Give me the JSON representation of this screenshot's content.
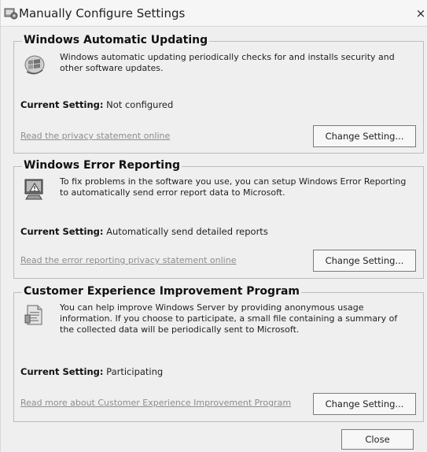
{
  "window": {
    "title": "Manually Configure Settings",
    "close_glyph": "×"
  },
  "groups": [
    {
      "title": "Windows Automatic Updating",
      "icon": "windows-update-icon",
      "description": "Windows automatic updating periodically checks for and installs security and other software updates.",
      "setting_label": "Current Setting:",
      "setting_value": "Not configured",
      "link": "Read the privacy statement online",
      "button": "Change Setting..."
    },
    {
      "title": "Windows Error Reporting",
      "icon": "error-reporting-icon",
      "description": "To fix problems in the software you use, you can setup Windows Error Reporting to automatically send error report data to Microsoft.",
      "setting_label": "Current Setting:",
      "setting_value": "Automatically send detailed reports",
      "link": "Read the error reporting privacy statement online",
      "button": "Change Setting..."
    },
    {
      "title": "Customer Experience Improvement Program",
      "icon": "ceip-document-icon",
      "description": "You can help improve Windows Server by providing anonymous usage information. If you choose to participate, a small file containing a summary of the collected data will be periodically sent to Microsoft.",
      "setting_label": "Current Setting:",
      "setting_value": "Participating",
      "link": "Read more about Customer Experience Improvement Program",
      "button": "Change Setting..."
    }
  ],
  "footer": {
    "close_button": "Close"
  }
}
